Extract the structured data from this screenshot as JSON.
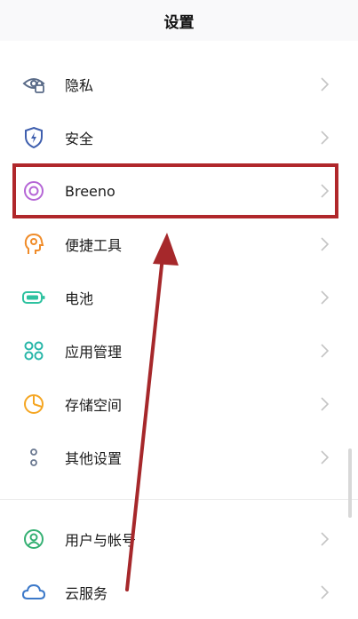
{
  "header": {
    "title": "设置"
  },
  "items": [
    {
      "label": "隐私",
      "icon": "privacy-eye-lock-icon",
      "color": "#5a6b88"
    },
    {
      "label": "安全",
      "icon": "shield-bolt-icon",
      "color": "#3f5fae"
    },
    {
      "label": "Breeno",
      "icon": "breeno-ring-icon",
      "color": "#b566d6"
    },
    {
      "label": "便捷工具",
      "icon": "head-gear-icon",
      "color": "#f08c2a"
    },
    {
      "label": "电池",
      "icon": "battery-icon",
      "color": "#2ec2a0"
    },
    {
      "label": "应用管理",
      "icon": "apps-grid-icon",
      "color": "#27b6a8"
    },
    {
      "label": "存储空间",
      "icon": "storage-pie-icon",
      "color": "#f5a623"
    },
    {
      "label": "其他设置",
      "icon": "more-dots-icon",
      "color": "#6a7890"
    },
    {
      "label": "用户与帐号",
      "icon": "user-account-icon",
      "color": "#35b073"
    },
    {
      "label": "云服务",
      "icon": "cloud-icon",
      "color": "#3c79c9"
    }
  ],
  "annotation": {
    "highlight_color": "#b0272b",
    "arrow_color": "#a6282b",
    "highlighted_item": "Breeno"
  }
}
